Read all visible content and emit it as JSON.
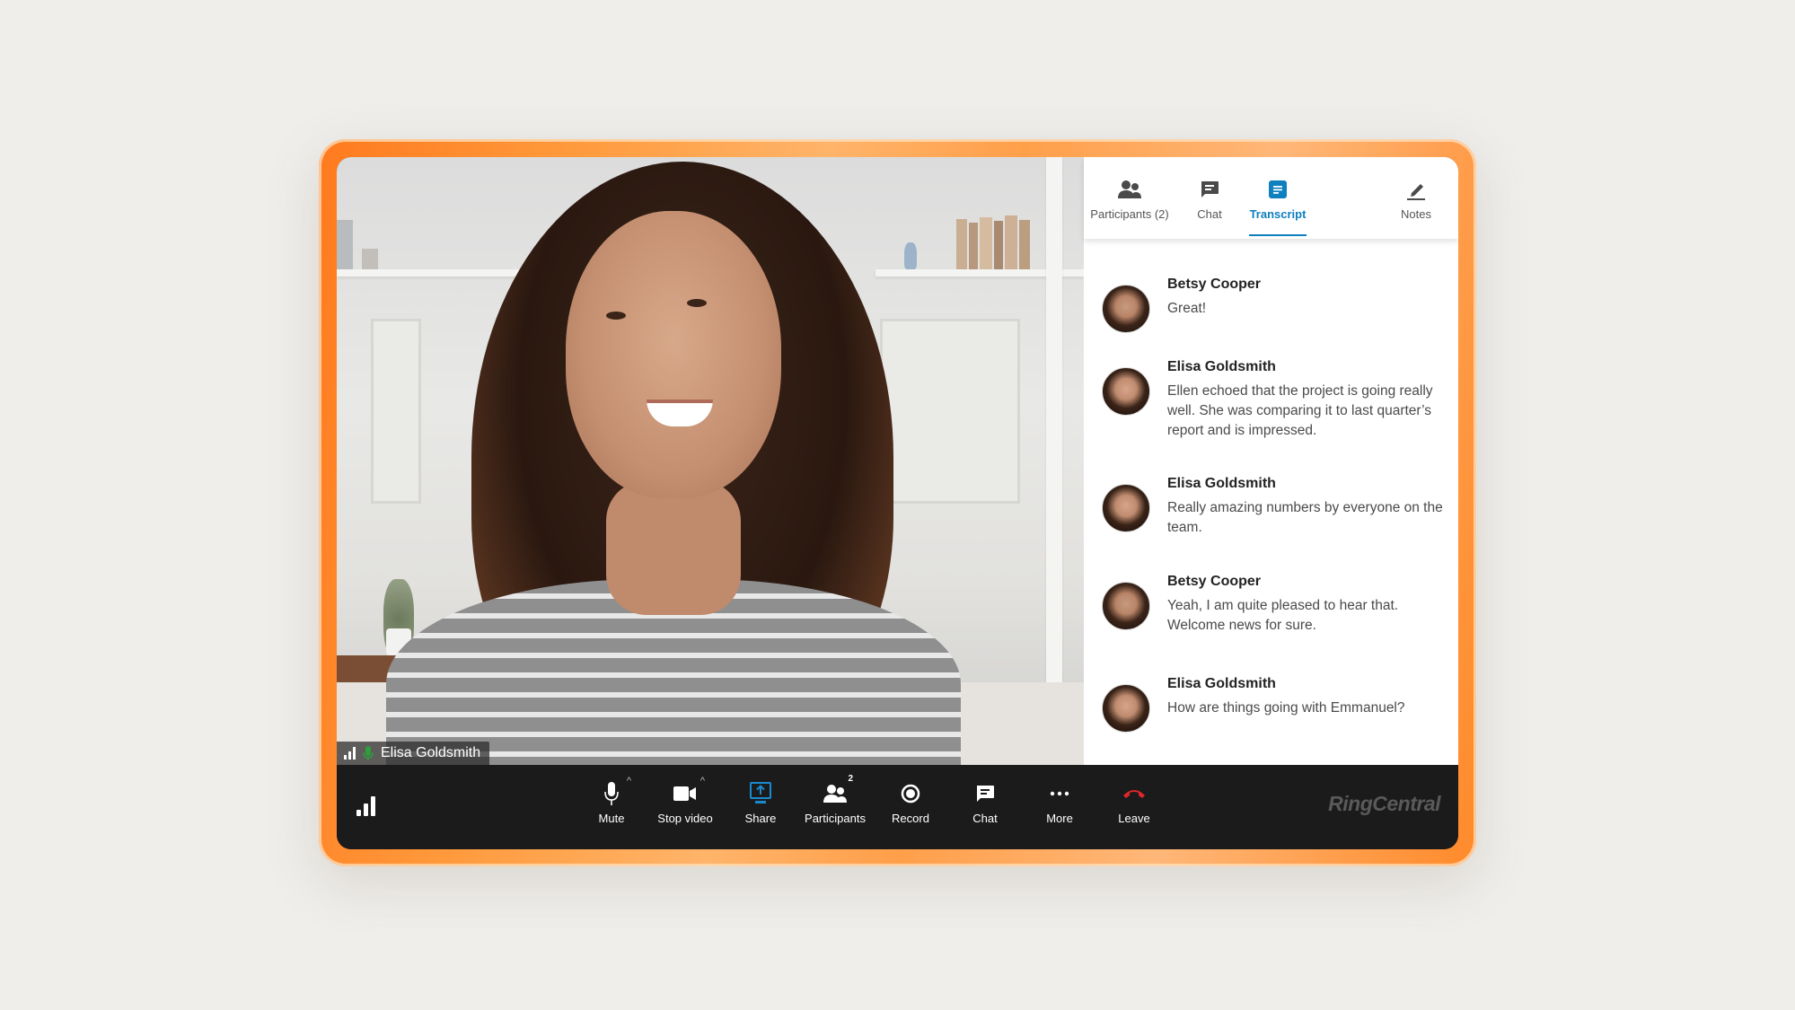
{
  "app": {
    "brand": "RingCentral",
    "accent_color": "#0e7fbf",
    "leave_color": "#e0262b",
    "mic_active_color": "#2f9e3a"
  },
  "video": {
    "participant_name": "Elisa Goldsmith",
    "signal_icon": "signal-bars-icon",
    "mic_icon": "microphone-active-icon"
  },
  "side_panel": {
    "tabs": [
      {
        "label": "Participants (2)",
        "icon": "participants-icon",
        "active": false
      },
      {
        "label": "Chat",
        "icon": "chat-bubble-icon",
        "active": false
      },
      {
        "label": "Transcript",
        "icon": "transcript-icon",
        "active": true
      },
      {
        "label": "Notes",
        "icon": "pencil-icon",
        "active": false
      }
    ],
    "transcript": [
      {
        "speaker": "Betsy Cooper",
        "text": "Great!"
      },
      {
        "speaker": "Elisa Goldsmith",
        "text": "Ellen echoed that the project is going really well. She was comparing it to last quarter’s report and is impressed."
      },
      {
        "speaker": "Elisa Goldsmith",
        "text": "Really amazing numbers by everyone on the team."
      },
      {
        "speaker": "Betsy Cooper",
        "text": "Yeah, I am quite pleased to hear that. Welcome news for sure."
      },
      {
        "speaker": "Elisa Goldsmith",
        "text": "How are things going with Emmanuel?"
      }
    ]
  },
  "toolbar": {
    "buttons": [
      {
        "label": "Mute",
        "icon": "microphone-icon",
        "has_caret": true
      },
      {
        "label": "Stop video",
        "icon": "video-camera-icon",
        "has_caret": true
      },
      {
        "label": "Share",
        "icon": "share-screen-icon",
        "active": true
      },
      {
        "label": "Participants",
        "icon": "participants-icon",
        "badge": "2"
      },
      {
        "label": "Record",
        "icon": "record-icon"
      },
      {
        "label": "Chat",
        "icon": "chat-bubble-icon"
      },
      {
        "label": "More",
        "icon": "more-dots-icon"
      },
      {
        "label": "Leave",
        "icon": "hang-up-icon"
      }
    ],
    "caret_glyph": "^"
  }
}
